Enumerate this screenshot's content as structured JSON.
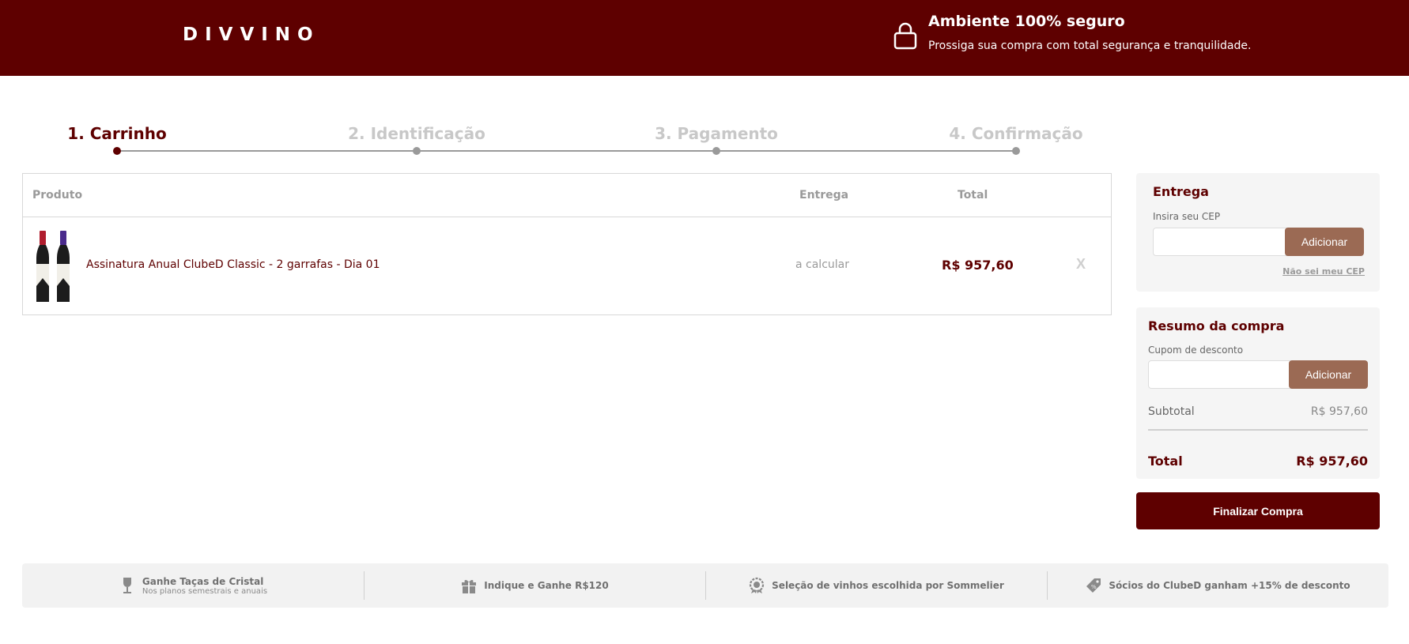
{
  "header": {
    "logo": "DIVVINO",
    "secure_title": "Ambiente 100% seguro",
    "secure_subtitle": "Prossiga sua compra com total segurança e tranquilidade."
  },
  "steps": [
    {
      "label": "1. Carrinho",
      "active": true
    },
    {
      "label": "2. Identificação",
      "active": false
    },
    {
      "label": "3. Pagamento",
      "active": false
    },
    {
      "label": "4. Confirmação",
      "active": false
    }
  ],
  "cart": {
    "columns": {
      "product": "Produto",
      "shipping": "Entrega",
      "total": "Total"
    },
    "items": [
      {
        "name": "Assinatura Anual ClubeD Classic - 2 garrafas - Dia 01",
        "shipping": "a calcular",
        "total": "R$ 957,60",
        "remove_label": "X"
      }
    ]
  },
  "shipping_panel": {
    "title": "Entrega",
    "cep_label": "Insira seu CEP",
    "cep_value": "",
    "add_label": "Adicionar",
    "dont_know_label": "Não sei meu CEP"
  },
  "summary": {
    "title": "Resumo da compra",
    "coupon_label": "Cupom de desconto",
    "coupon_value": "",
    "add_label": "Adicionar",
    "subtotal_label": "Subtotal",
    "subtotal_value": "R$ 957,60",
    "total_label": "Total",
    "total_value": "R$ 957,60"
  },
  "finalize_label": "Finalizar Compra",
  "benefits": [
    {
      "icon": "wine-glass-icon",
      "title": "Ganhe Taças de Cristal",
      "subtitle": "Nos planos semestrais e anuais"
    },
    {
      "icon": "gift-icon",
      "title": "Indique e Ganhe R$120",
      "subtitle": ""
    },
    {
      "icon": "award-icon",
      "title": "Seleção de vinhos escolhida por Sommelier",
      "subtitle": ""
    },
    {
      "icon": "tag-icon",
      "title": "Sócios do ClubeD ganham +15% de desconto",
      "subtitle": ""
    }
  ],
  "colors": {
    "brand": "#5e0000",
    "button_secondary": "#9b6a54",
    "muted": "#9a9a9a"
  }
}
